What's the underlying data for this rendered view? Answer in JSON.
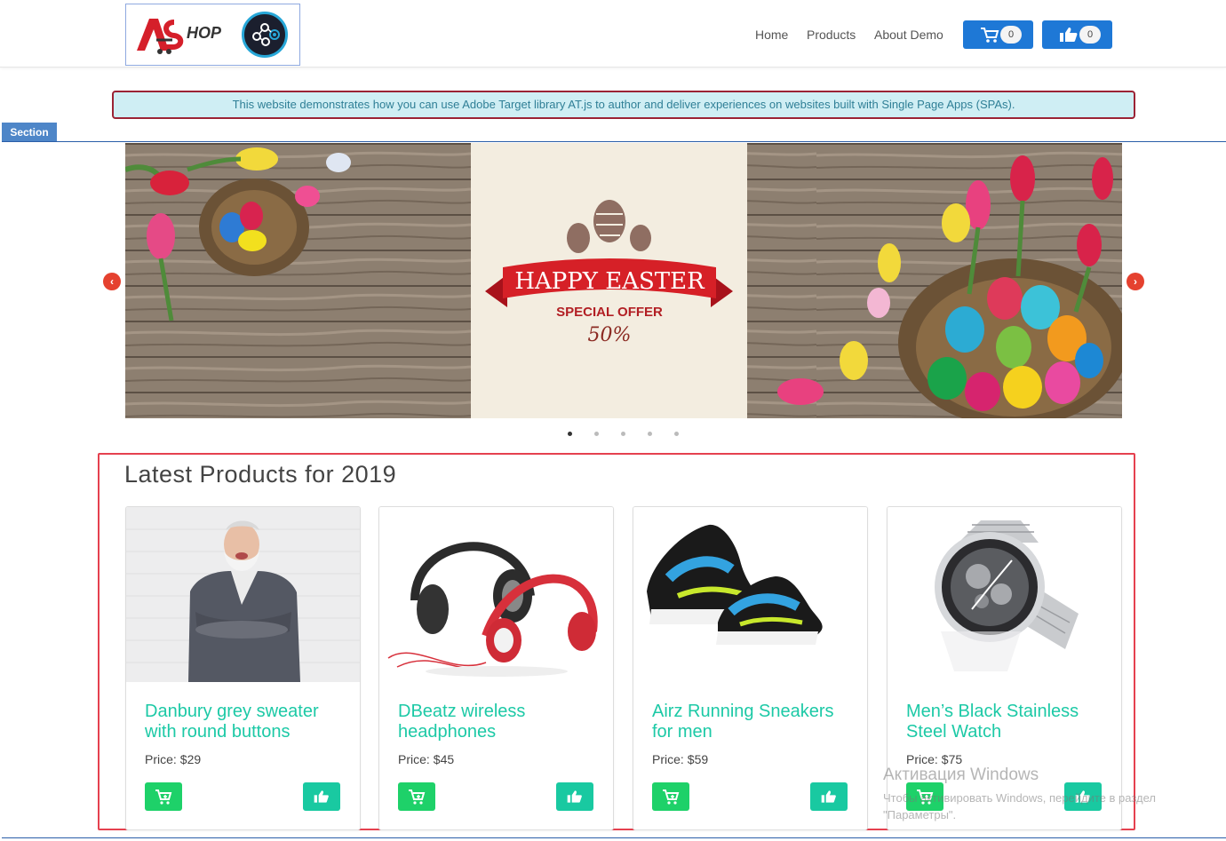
{
  "header": {
    "logo_text": "HOP",
    "nav": [
      {
        "label": "Home"
      },
      {
        "label": "Products"
      },
      {
        "label": "About Demo"
      }
    ],
    "cart_count": "0",
    "likes_count": "0"
  },
  "notice": {
    "text": "This website demonstrates how you can use Adobe Target library AT.js to author and deliver experiences on websites built with Single Page Apps (SPAs)."
  },
  "section_tab": "Section",
  "banner": {
    "line1": "HAPPY EASTER",
    "line2": "SPECIAL OFFER",
    "line3": "50%"
  },
  "carousel": {
    "dots": 5,
    "active_dot": 0
  },
  "products": {
    "title": "Latest Products for 2019",
    "items": [
      {
        "name": "Danbury grey sweater with round buttons",
        "price_label": "Price:",
        "price": "$29"
      },
      {
        "name": "DBeatz wireless headphones",
        "price_label": "Price:",
        "price": "$45"
      },
      {
        "name": "Airz Running Sneakers for men",
        "price_label": "Price:",
        "price": "$59"
      },
      {
        "name": "Men’s Black Stainless Steel Watch",
        "price_label": "Price:",
        "price": "$75"
      }
    ]
  },
  "watermark": {
    "line1": "Активация Windows",
    "line2": "Чтобы активировать Windows, перейдите в раздел",
    "line3": "\"Параметры\"."
  },
  "colors": {
    "nav_button": "#1e78d6",
    "product_name": "#1cc9a6",
    "cart_button": "#1ed169",
    "like_button": "#19c9a1",
    "notice_border": "#9b2335",
    "notice_bg": "#cfeef4",
    "highlight_frame": "#e5414f"
  }
}
